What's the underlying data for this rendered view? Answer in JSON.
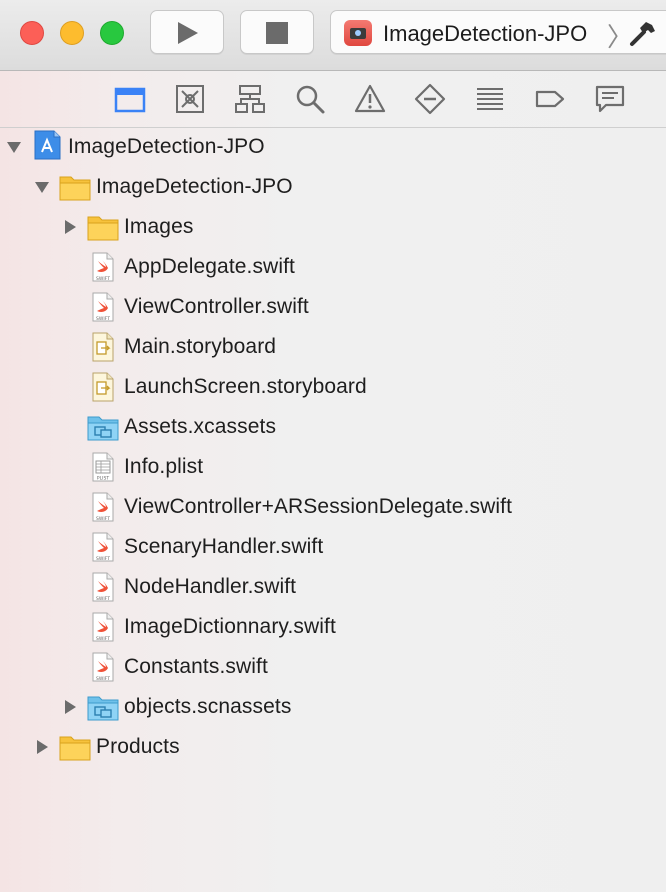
{
  "toolbar": {
    "scheme_label": "ImageDetection-JPO",
    "scheme_chevron": "〉",
    "icons": [
      "close-light",
      "minimize-light",
      "zoom-light",
      "run-icon",
      "stop-icon",
      "app-scheme-icon",
      "hammer-icon"
    ]
  },
  "navigator": {
    "tabs": [
      "project-navigator",
      "source-control-navigator",
      "symbol-navigator",
      "find-navigator",
      "issue-navigator",
      "test-navigator",
      "debug-navigator",
      "breakpoint-navigator",
      "report-navigator"
    ],
    "selected_tab": "project-navigator",
    "accent_color": "#3a82f6"
  },
  "tree": {
    "project": "ImageDetection-JPO",
    "group": "ImageDetection-JPO",
    "images_folder": "Images",
    "files": [
      "AppDelegate.swift",
      "ViewController.swift",
      "Main.storyboard",
      "LaunchScreen.storyboard",
      "Assets.xcassets",
      "Info.plist",
      "ViewController+ARSessionDelegate.swift",
      "ScenaryHandler.swift",
      "NodeHandler.swift",
      "ImageDictionnary.swift",
      "Constants.swift"
    ],
    "scnassets_folder": "objects.scnassets",
    "products_folder": "Products"
  }
}
